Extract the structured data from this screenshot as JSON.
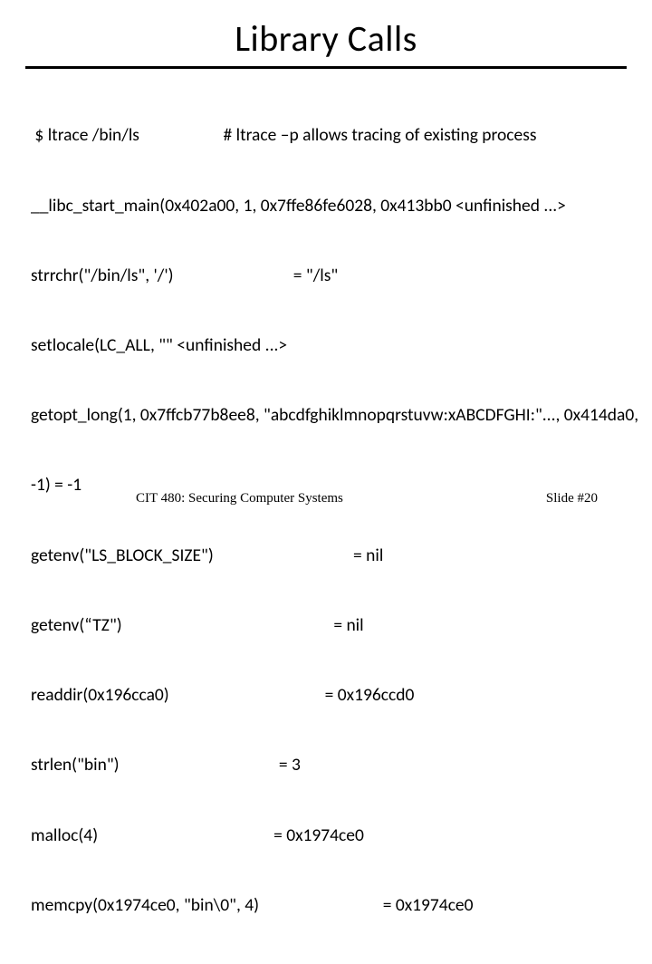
{
  "title": "Library Calls",
  "lines": [
    " $ ltrace /bin/ls                     # ltrace –p allows tracing of existing process",
    "__libc_start_main(0x402a00, 1, 0x7ffe86fe6028, 0x413bb0 <unfinished ...>",
    "strrchr(\"/bin/ls\", '/')                              = \"/ls\"",
    "setlocale(LC_ALL, \"\" <unfinished ...>",
    "getopt_long(1, 0x7ffcb77b8ee8, \"abcdfghiklmnopqrstuvw:xABCDFGHI:\"..., 0x414da0,",
    "-1) = -1",
    "getenv(\"LS_BLOCK_SIZE\")                                   = nil",
    "getenv(“TZ\")                                                     = nil",
    "readdir(0x196cca0)                                       = 0x196ccd0",
    "strlen(\"bin\")                                        = 3",
    "malloc(4)                                            = 0x1974ce0",
    "memcpy(0x1974ce0, \"bin\\0\", 4)                               = 0x1974ce0"
  ],
  "footer": {
    "left": "CIT 480: Securing Computer Systems",
    "right": "Slide #20"
  }
}
